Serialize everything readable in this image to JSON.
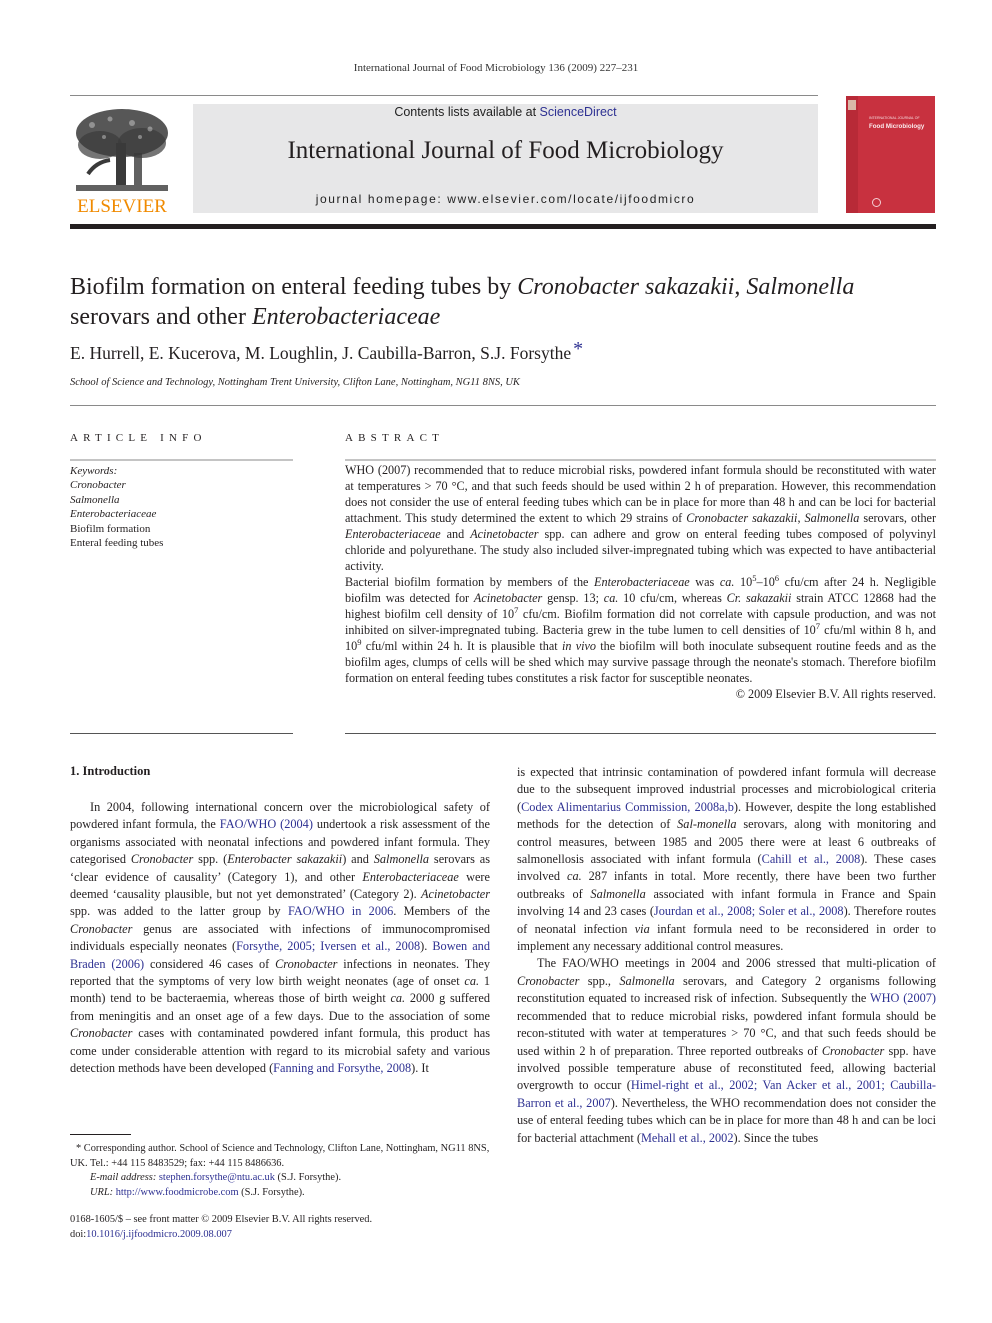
{
  "running_head": "International Journal of Food Microbiology 136 (2009) 227–231",
  "masthead": {
    "publisher_logo_text": "ELSEVIER",
    "contents_prefix": "Contents lists available at ",
    "contents_link": "ScienceDirect",
    "journal_name": "International Journal of Food Microbiology",
    "homepage": "journal homepage: www.elsevier.com/locate/ijfoodmicro",
    "cover_small_text": "INTERNATIONAL JOURNAL OF",
    "cover_title": "Food Microbiology"
  },
  "article": {
    "title_parts": [
      "Biofilm formation on enteral feeding tubes by ",
      "Cronobacter sakazakii",
      ", ",
      "Salmonella",
      " serovars and other ",
      "Enterobacteriaceae"
    ],
    "authors": "E. Hurrell, E. Kucerova, M. Loughlin, J. Caubilla-Barron, S.J. Forsythe",
    "corresponding_marker": "*",
    "affiliation": "School of Science and Technology, Nottingham Trent University, Clifton Lane, Nottingham, NG11 8NS, UK"
  },
  "article_info": {
    "label": "ARTICLE INFO",
    "keywords_label": "Keywords:",
    "keywords": [
      "Cronobacter",
      "Salmonella",
      "Enterobacteriaceae",
      "Biofilm formation",
      "Enteral feeding tubes"
    ]
  },
  "abstract": {
    "label": "ABSTRACT",
    "p1": [
      {
        "t": "WHO (2007) recommended that to reduce microbial risks, powdered infant formula should be reconstituted with water at temperatures > 70 °C, and that such feeds should be used within 2 h of preparation. However, this recommendation does not consider the use of enteral feeding tubes which can be in place for more than 48 h and can be loci for bacterial attachment. This study determined the extent to which 29 strains of "
      },
      {
        "t": "Cronobacter sakazakii",
        "i": true
      },
      {
        "t": ", "
      },
      {
        "t": "Salmonella",
        "i": true
      },
      {
        "t": " serovars, other "
      },
      {
        "t": "Enterobacteriaceae",
        "i": true
      },
      {
        "t": " and "
      },
      {
        "t": "Acinetobacter",
        "i": true
      },
      {
        "t": " spp. can adhere and grow on enteral feeding tubes composed of polyvinyl chloride and polyurethane. The study also included silver-impregnated tubing which was expected to have antibacterial activity."
      }
    ],
    "p2": [
      {
        "t": "Bacterial biofilm formation by members of the "
      },
      {
        "t": "Enterobacteriaceae",
        "i": true
      },
      {
        "t": " was "
      },
      {
        "t": "ca.",
        "i": true
      },
      {
        "t": " 10"
      },
      {
        "t": "5",
        "sup": true
      },
      {
        "t": "–10"
      },
      {
        "t": "6",
        "sup": true
      },
      {
        "t": " cfu/cm after 24 h. Negligible biofilm was detected for "
      },
      {
        "t": "Acinetobacter",
        "i": true
      },
      {
        "t": " gensp. 13; "
      },
      {
        "t": "ca.",
        "i": true
      },
      {
        "t": " 10 cfu/cm, whereas "
      },
      {
        "t": "Cr. sakazakii",
        "i": true
      },
      {
        "t": " strain ATCC 12868 had the highest biofilm cell density of 10"
      },
      {
        "t": "7",
        "sup": true
      },
      {
        "t": " cfu/cm. Biofilm formation did not correlate with capsule production, and was not inhibited on silver-impregnated tubing. Bacteria grew in the tube lumen to cell densities of 10"
      },
      {
        "t": "7",
        "sup": true
      },
      {
        "t": " cfu/ml within 8 h, and 10"
      },
      {
        "t": "9",
        "sup": true
      },
      {
        "t": " cfu/ml within 24 h. It is plausible that "
      },
      {
        "t": "in vivo",
        "i": true
      },
      {
        "t": " the biofilm will both inoculate subsequent routine feeds and as the biofilm ages, clumps of cells will be shed which may survive passage through the neonate's stomach. Therefore biofilm formation on enteral feeding tubes constitutes a risk factor for susceptible neonates."
      }
    ],
    "copyright": "© 2009 Elsevier B.V. All rights reserved."
  },
  "introduction": {
    "heading": "1. Introduction",
    "left_column": [
      {
        "t": "In 2004, following international concern over the microbiological safety of powdered infant formula, the "
      },
      {
        "t": "FAO/WHO (2004)",
        "link": true
      },
      {
        "t": " undertook a risk assessment of the organisms associated with neonatal infections and powdered infant formula. They categorised "
      },
      {
        "t": "Cronobacter",
        "i": true
      },
      {
        "t": " spp. ("
      },
      {
        "t": "Enterobacter sakazakii",
        "i": true
      },
      {
        "t": ") and "
      },
      {
        "t": "Salmonella",
        "i": true
      },
      {
        "t": " serovars as ‘clear evidence of causality’ (Category 1), and other "
      },
      {
        "t": "Enterobacteriaceae",
        "i": true
      },
      {
        "t": " were deemed ‘causality plausible, but not yet demonstrated’ (Category 2). "
      },
      {
        "t": "Acinetobacter",
        "i": true
      },
      {
        "t": " spp. was added to the latter group by "
      },
      {
        "t": "FAO/WHO in 2006",
        "link": true
      },
      {
        "t": ". Members of the "
      },
      {
        "t": "Cronobacter",
        "i": true
      },
      {
        "t": " genus are associated with infections of immunocompromised individuals especially neonates ("
      },
      {
        "t": "Forsythe, 2005; Iversen et al., 2008",
        "link": true
      },
      {
        "t": "). "
      },
      {
        "t": "Bowen and Braden (2006)",
        "link": true
      },
      {
        "t": " considered 46 cases of "
      },
      {
        "t": "Cronobacter",
        "i": true
      },
      {
        "t": " infections in neonates. They reported that the symptoms of very low birth weight neonates (age of onset "
      },
      {
        "t": "ca.",
        "i": true
      },
      {
        "t": " 1 month) tend to be bacteraemia, whereas those of birth weight "
      },
      {
        "t": "ca.",
        "i": true
      },
      {
        "t": " 2000 g suffered from meningitis and an onset age of a few days. Due to the association of some "
      },
      {
        "t": "Cronobacter",
        "i": true
      },
      {
        "t": " cases with contaminated powdered infant formula, this product has come under considerable attention with regard to its microbial safety and various detection methods have been developed ("
      },
      {
        "t": "Fanning and Forsythe, 2008",
        "link": true
      },
      {
        "t": "). It"
      }
    ],
    "right_column_p1": [
      {
        "t": "is expected that intrinsic contamination of powdered infant formula will decrease due to the subsequent improved industrial processes and microbiological criteria ("
      },
      {
        "t": "Codex Alimentarius Commission, 2008a,b",
        "link": true
      },
      {
        "t": "). However, despite the long established methods for the detection of "
      },
      {
        "t": "Sal-monella",
        "i": true
      },
      {
        "t": " serovars, along with monitoring and control measures, between 1985 and 2005 there were at least 6 outbreaks of salmonellosis associated with infant formula ("
      },
      {
        "t": "Cahill et al., 2008",
        "link": true
      },
      {
        "t": "). These cases involved "
      },
      {
        "t": "ca.",
        "i": true
      },
      {
        "t": " 287 infants in total. More recently, there have been two further outbreaks of "
      },
      {
        "t": "Salmonella",
        "i": true
      },
      {
        "t": " associated with infant formula in France and Spain involving 14 and 23 cases ("
      },
      {
        "t": "Jourdan et al., 2008; Soler et al., 2008",
        "link": true
      },
      {
        "t": "). Therefore routes of neonatal infection "
      },
      {
        "t": "via",
        "i": true
      },
      {
        "t": " infant formula need to be reconsidered in order to implement any necessary additional control measures."
      }
    ],
    "right_column_p2": [
      {
        "t": "The FAO/WHO meetings in 2004 and 2006 stressed that multi-plication of "
      },
      {
        "t": "Cronobacter",
        "i": true
      },
      {
        "t": " spp., "
      },
      {
        "t": "Salmonella",
        "i": true
      },
      {
        "t": " serovars, and Category 2 organisms following reconstitution equated to increased risk of infection. Subsequently the "
      },
      {
        "t": "WHO (2007)",
        "link": true
      },
      {
        "t": " recommended that to reduce microbial risks, powdered infant formula should be recon-stituted with water at temperatures > 70 °C, and that such feeds should be used within 2 h of preparation. Three reported outbreaks of "
      },
      {
        "t": "Cronobacter",
        "i": true
      },
      {
        "t": " spp. have involved possible temperature abuse of reconstituted feed, allowing bacterial overgrowth to occur ("
      },
      {
        "t": "Himel-right et al., 2002; Van Acker et al., 2001; Caubilla-Barron et al., 2007",
        "link": true
      },
      {
        "t": "). Nevertheless, the WHO recommendation does not consider the use of enteral feeding tubes which can be in place for more than 48 h and can be loci for bacterial attachment ("
      },
      {
        "t": "Mehall et al., 2002",
        "link": true
      },
      {
        "t": "). Since the tubes"
      }
    ]
  },
  "footnotes": {
    "corresponding": "* Corresponding author. School of Science and Technology, Clifton Lane, Nottingham, NG11 8NS, UK. Tel.: +44 115 8483529; fax: +44 115 8486636.",
    "email_label": "E-mail address:",
    "email": "stephen.forsythe@ntu.ac.uk",
    "email_suffix": " (S.J. Forsythe).",
    "url_label": "URL:",
    "url": "http://www.foodmicrobe.com",
    "url_suffix": " (S.J. Forsythe).",
    "front_matter": "0168-1605/$ – see front matter © 2009 Elsevier B.V. All rights reserved.",
    "doi_label": "doi:",
    "doi": "10.1016/j.ijfoodmicro.2009.08.007"
  },
  "colors": {
    "link": "#2e3192",
    "elsevier_orange": "#f08a00",
    "cover_red": "#c8313f",
    "masthead_gray": "#e7e7e8"
  }
}
